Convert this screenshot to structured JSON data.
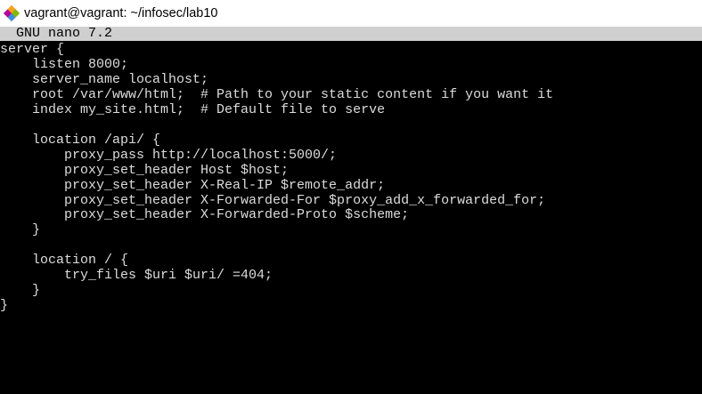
{
  "window": {
    "title": "vagrant@vagrant: ~/infosec/lab10",
    "icon": "git-bash-diamond-icon"
  },
  "nano": {
    "header": "GNU nano 7.2"
  },
  "editor": {
    "lines": [
      "server {",
      "    listen 8000;",
      "    server_name localhost;",
      "    root /var/www/html;  # Path to your static content if you want it",
      "    index my_site.html;  # Default file to serve",
      "",
      "    location /api/ {",
      "        proxy_pass http://localhost:5000/;",
      "        proxy_set_header Host $host;",
      "        proxy_set_header X-Real-IP $remote_addr;",
      "        proxy_set_header X-Forwarded-For $proxy_add_x_forwarded_for;",
      "        proxy_set_header X-Forwarded-Proto $scheme;",
      "    }",
      "",
      "    location / {",
      "        try_files $uri $uri/ =404;",
      "    }",
      "}"
    ]
  },
  "colors": {
    "terminal_bg": "#000000",
    "terminal_fg": "#dcdcdc",
    "header_bg": "#cfcfcf",
    "titlebar_bg": "#ffffff"
  }
}
